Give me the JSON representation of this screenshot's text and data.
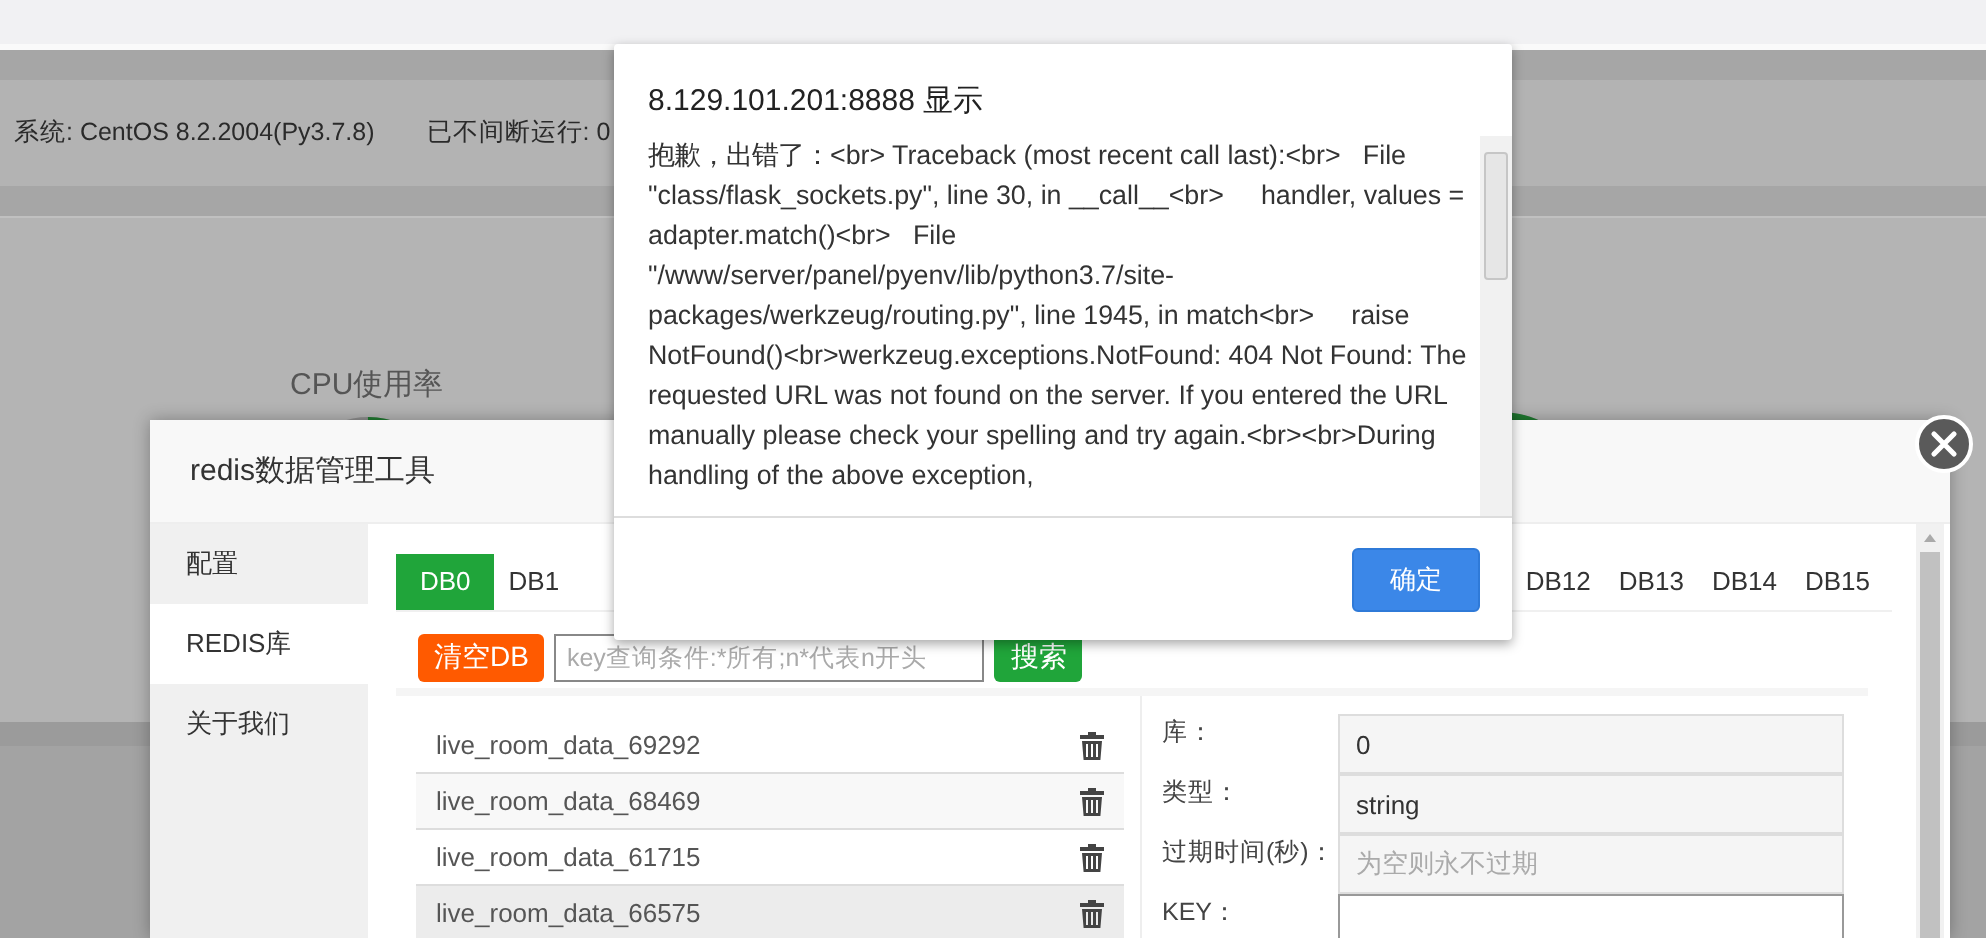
{
  "page": {
    "system_info": "系统:  CentOS 8.2.2004(Py3.7.8)",
    "uptime": "已不间断运行: 0",
    "cpu_title": "CPU使用率"
  },
  "redis_tool": {
    "title": "redis数据管理工具",
    "sidebar": [
      {
        "label": "配置",
        "selected": false
      },
      {
        "label": "REDIS库",
        "selected": true
      },
      {
        "label": "关于我们",
        "selected": false
      }
    ],
    "db_tabs": [
      {
        "label": "DB0",
        "selected": true
      },
      {
        "label": "DB1",
        "selected": false
      },
      {
        "label": "DB12",
        "selected": false
      },
      {
        "label": "DB13",
        "selected": false
      },
      {
        "label": "DB14",
        "selected": false
      },
      {
        "label": "DB15",
        "selected": false
      }
    ],
    "clear_button": "清空DB",
    "search": {
      "placeholder": "key查询条件:*所有;n*代表n开头"
    },
    "search_button": "搜索",
    "keys": [
      {
        "name": "live_room_data_69292",
        "selected": false
      },
      {
        "name": "live_room_data_68469",
        "selected": false
      },
      {
        "name": "live_room_data_61715",
        "selected": false
      },
      {
        "name": "live_room_data_66575",
        "selected": true
      }
    ],
    "fields": [
      {
        "label": "库：",
        "value": "0",
        "kind": "readonly"
      },
      {
        "label": "类型：",
        "value": "string",
        "kind": "readonly"
      },
      {
        "label": "过期时间(秒)：",
        "placeholder": "为空则永不过期",
        "kind": "readonly"
      },
      {
        "label": "KEY：",
        "kind": "editable"
      }
    ]
  },
  "alert": {
    "title": "8.129.101.201:8888 显示",
    "message": "抱歉，出错了：<br> Traceback (most recent call last):<br>   File \"class/flask_sockets.py\", line 30, in __call__<br>     handler, values = adapter.match()<br>   File \"/www/server/panel/pyenv/lib/python3.7/site-packages/werkzeug/routing.py\", line 1945, in match<br>     raise NotFound()<br>werkzeug.exceptions.NotFound: 404 Not Found: The requested URL was not found on the server. If you entered the URL manually please check your spelling and try again.<br><br>During handling of the above exception,",
    "ok_button": "确定"
  }
}
